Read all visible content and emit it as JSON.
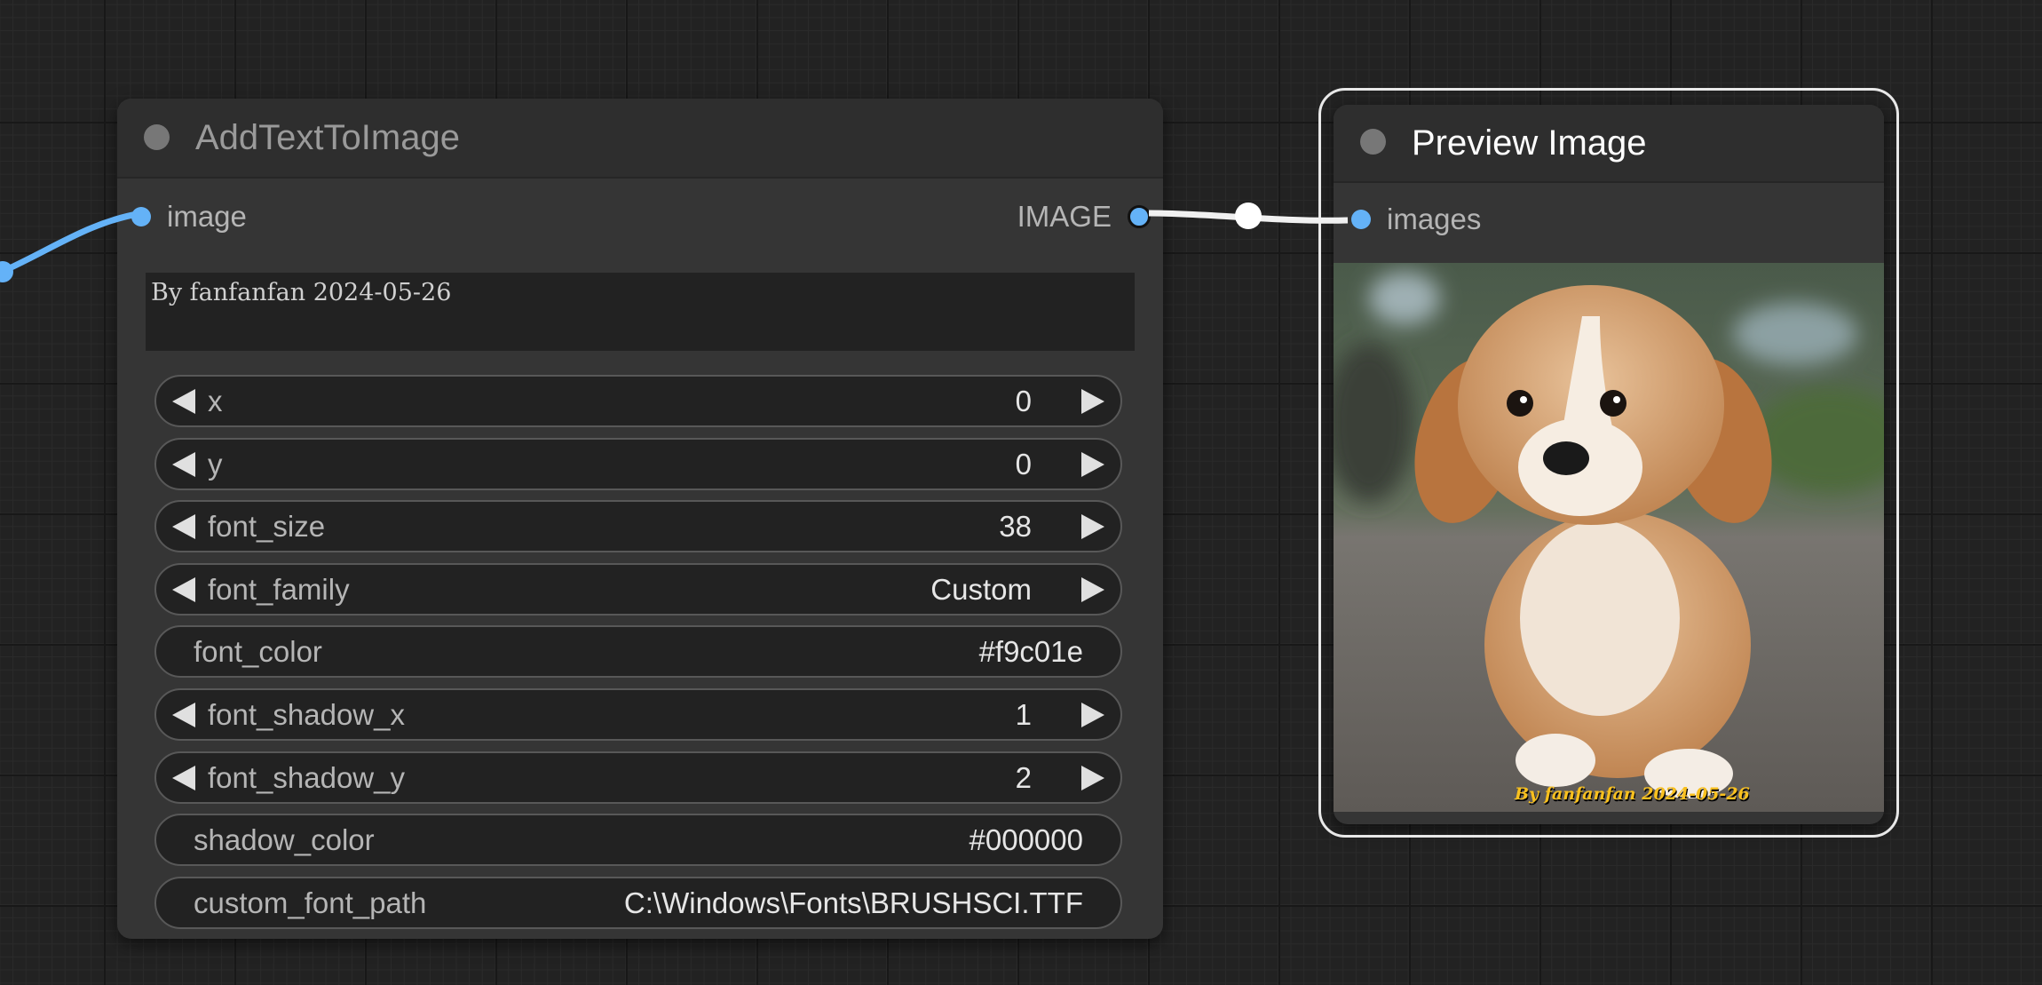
{
  "colors": {
    "canvas_bg": "#222222",
    "node_bg": "#353535",
    "node_title_bg": "#2e2e2e",
    "widget_bg": "#222222",
    "slot_image": "#64b2f7",
    "font_color_value": "#f9c01e"
  },
  "add_node": {
    "title": "AddTextToImage",
    "input_slot": "image",
    "output_slot": "IMAGE",
    "text_value": "By fanfanfan 2024-05-26",
    "widgets": [
      {
        "label": "x",
        "value": "0",
        "type": "number"
      },
      {
        "label": "y",
        "value": "0",
        "type": "number"
      },
      {
        "label": "font_size",
        "value": "38",
        "type": "number"
      },
      {
        "label": "font_family",
        "value": "Custom",
        "type": "combo"
      },
      {
        "label": "font_color",
        "value": "#f9c01e",
        "type": "text"
      },
      {
        "label": "font_shadow_x",
        "value": "1",
        "type": "number"
      },
      {
        "label": "font_shadow_y",
        "value": "2",
        "type": "number"
      },
      {
        "label": "shadow_color",
        "value": "#000000",
        "type": "text"
      },
      {
        "label": "custom_font_path",
        "value": "C:\\Windows\\Fonts\\BRUSHSCI.TTF",
        "type": "text"
      }
    ]
  },
  "preview_node": {
    "title": "Preview Image",
    "input_slot": "images",
    "image_overlay_text": "By fanfanfan 2024-05-26",
    "image_icon": "puppy-photo"
  }
}
